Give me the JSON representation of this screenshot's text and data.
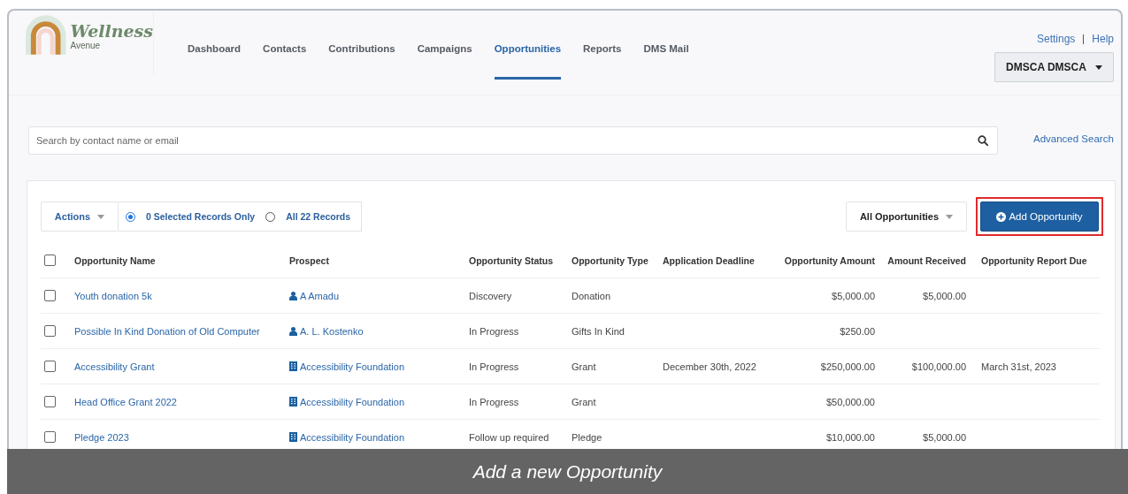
{
  "logo": {
    "title": "Wellness",
    "subtitle": "Avenue"
  },
  "nav": [
    {
      "label": "Dashboard",
      "selected": false
    },
    {
      "label": "Contacts",
      "selected": false
    },
    {
      "label": "Contributions",
      "selected": false
    },
    {
      "label": "Campaigns",
      "selected": false
    },
    {
      "label": "Opportunities",
      "selected": true
    },
    {
      "label": "Reports",
      "selected": false
    },
    {
      "label": "DMS Mail",
      "selected": false
    }
  ],
  "top_links": [
    "Settings",
    "Help"
  ],
  "user_menu": "DMSCA DMSCA",
  "search": {
    "placeholder": "Search by contact name or email",
    "advanced_link": "Advanced Search"
  },
  "toolbar": {
    "actions": "Actions",
    "scope": [
      {
        "label": "0 Selected Records Only",
        "selected": true
      },
      {
        "label": "All 22 Records",
        "selected": false
      }
    ],
    "filter": "All Opportunities",
    "add_button": "Add Opportunity",
    "add_button_highlighted": true
  },
  "table": {
    "columns": [
      "Opportunity Name",
      "Prospect",
      "Opportunity Status",
      "Opportunity Type",
      "Application Deadline",
      "Opportunity Amount",
      "Amount Received",
      "Opportunity Report Due"
    ],
    "header_checked": false,
    "rows": [
      {
        "checked": false,
        "name": "Youth donation 5k",
        "prospect": {
          "kind": "person",
          "label": "A Amadu"
        },
        "status": "Discovery",
        "type": "Donation",
        "deadline": "",
        "amount": "$5,000.00",
        "received": "$5,000.00",
        "report_due": ""
      },
      {
        "checked": false,
        "name": "Possible In Kind Donation of Old Computer",
        "prospect": {
          "kind": "person",
          "label": "A. L. Kostenko"
        },
        "status": "In Progress",
        "type": "Gifts In Kind",
        "deadline": "",
        "amount": "$250.00",
        "received": "",
        "report_due": ""
      },
      {
        "checked": false,
        "name": "Accessibility Grant",
        "prospect": {
          "kind": "organization",
          "label": "Accessibility Foundation"
        },
        "status": "In Progress",
        "type": "Grant",
        "deadline": "December 30th, 2022",
        "amount": "$250,000.00",
        "received": "$100,000.00",
        "report_due": "March 31st, 2023"
      },
      {
        "checked": false,
        "name": "Head Office Grant 2022",
        "prospect": {
          "kind": "organization",
          "label": "Accessibility Foundation"
        },
        "status": "In Progress",
        "type": "Grant",
        "deadline": "",
        "amount": "$50,000.00",
        "received": "",
        "report_due": ""
      },
      {
        "checked": false,
        "name": "Pledge 2023",
        "prospect": {
          "kind": "organization",
          "label": "Accessibility Foundation"
        },
        "status": "Follow up required",
        "type": "Pledge",
        "deadline": "",
        "amount": "$10,000.00",
        "received": "$5,000.00",
        "report_due": ""
      }
    ]
  },
  "caption": "Add a new Opportunity"
}
